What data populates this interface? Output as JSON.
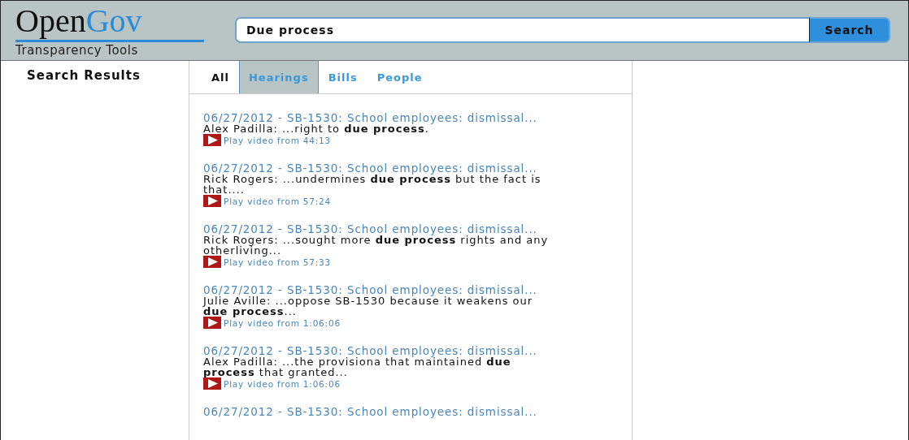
{
  "logo": {
    "primary": "Open",
    "accent": "Gov",
    "tagline": "Transparency Tools"
  },
  "search": {
    "value": "Due process",
    "button": "Search"
  },
  "sidebar": {
    "title": "Search Results"
  },
  "tabs": [
    {
      "label": "All",
      "selected": false
    },
    {
      "label": "Hearings",
      "selected": true
    },
    {
      "label": "Bills",
      "selected": false
    },
    {
      "label": "People",
      "selected": false
    }
  ],
  "results": [
    {
      "title": "06/27/2012 - SB-1530: School employees: dismissal...",
      "snippet": "Alex Padilla: ...right to **due process**.",
      "play": "Play video from 44:13"
    },
    {
      "title": "06/27/2012 - SB-1530: School employees: dismissal...",
      "snippet": "Rick Rogers: ...undermines **due process** but the fact is that....",
      "play": "Play video from 57:24"
    },
    {
      "title": "06/27/2012 - SB-1530: School employees: dismissal...",
      "snippet": "Rick Rogers: ...sought more **due process** rights and any otherliving...",
      "play": "Play video from 57:33"
    },
    {
      "title": "06/27/2012 - SB-1530: School employees: dismissal...",
      "snippet": "Julie Aville: ...oppose SB-1530 because it weakens our **due process**...",
      "play": "Play video from 1:06:06"
    },
    {
      "title": "06/27/2012 - SB-1530: School employees: dismissal...",
      "snippet": "Alex Padilla: ...the provisiona that maintained **due process** that granted...",
      "play": "Play video from 1:06:06"
    },
    {
      "title": "06/27/2012 - SB-1530: School employees: dismissal..."
    }
  ]
}
